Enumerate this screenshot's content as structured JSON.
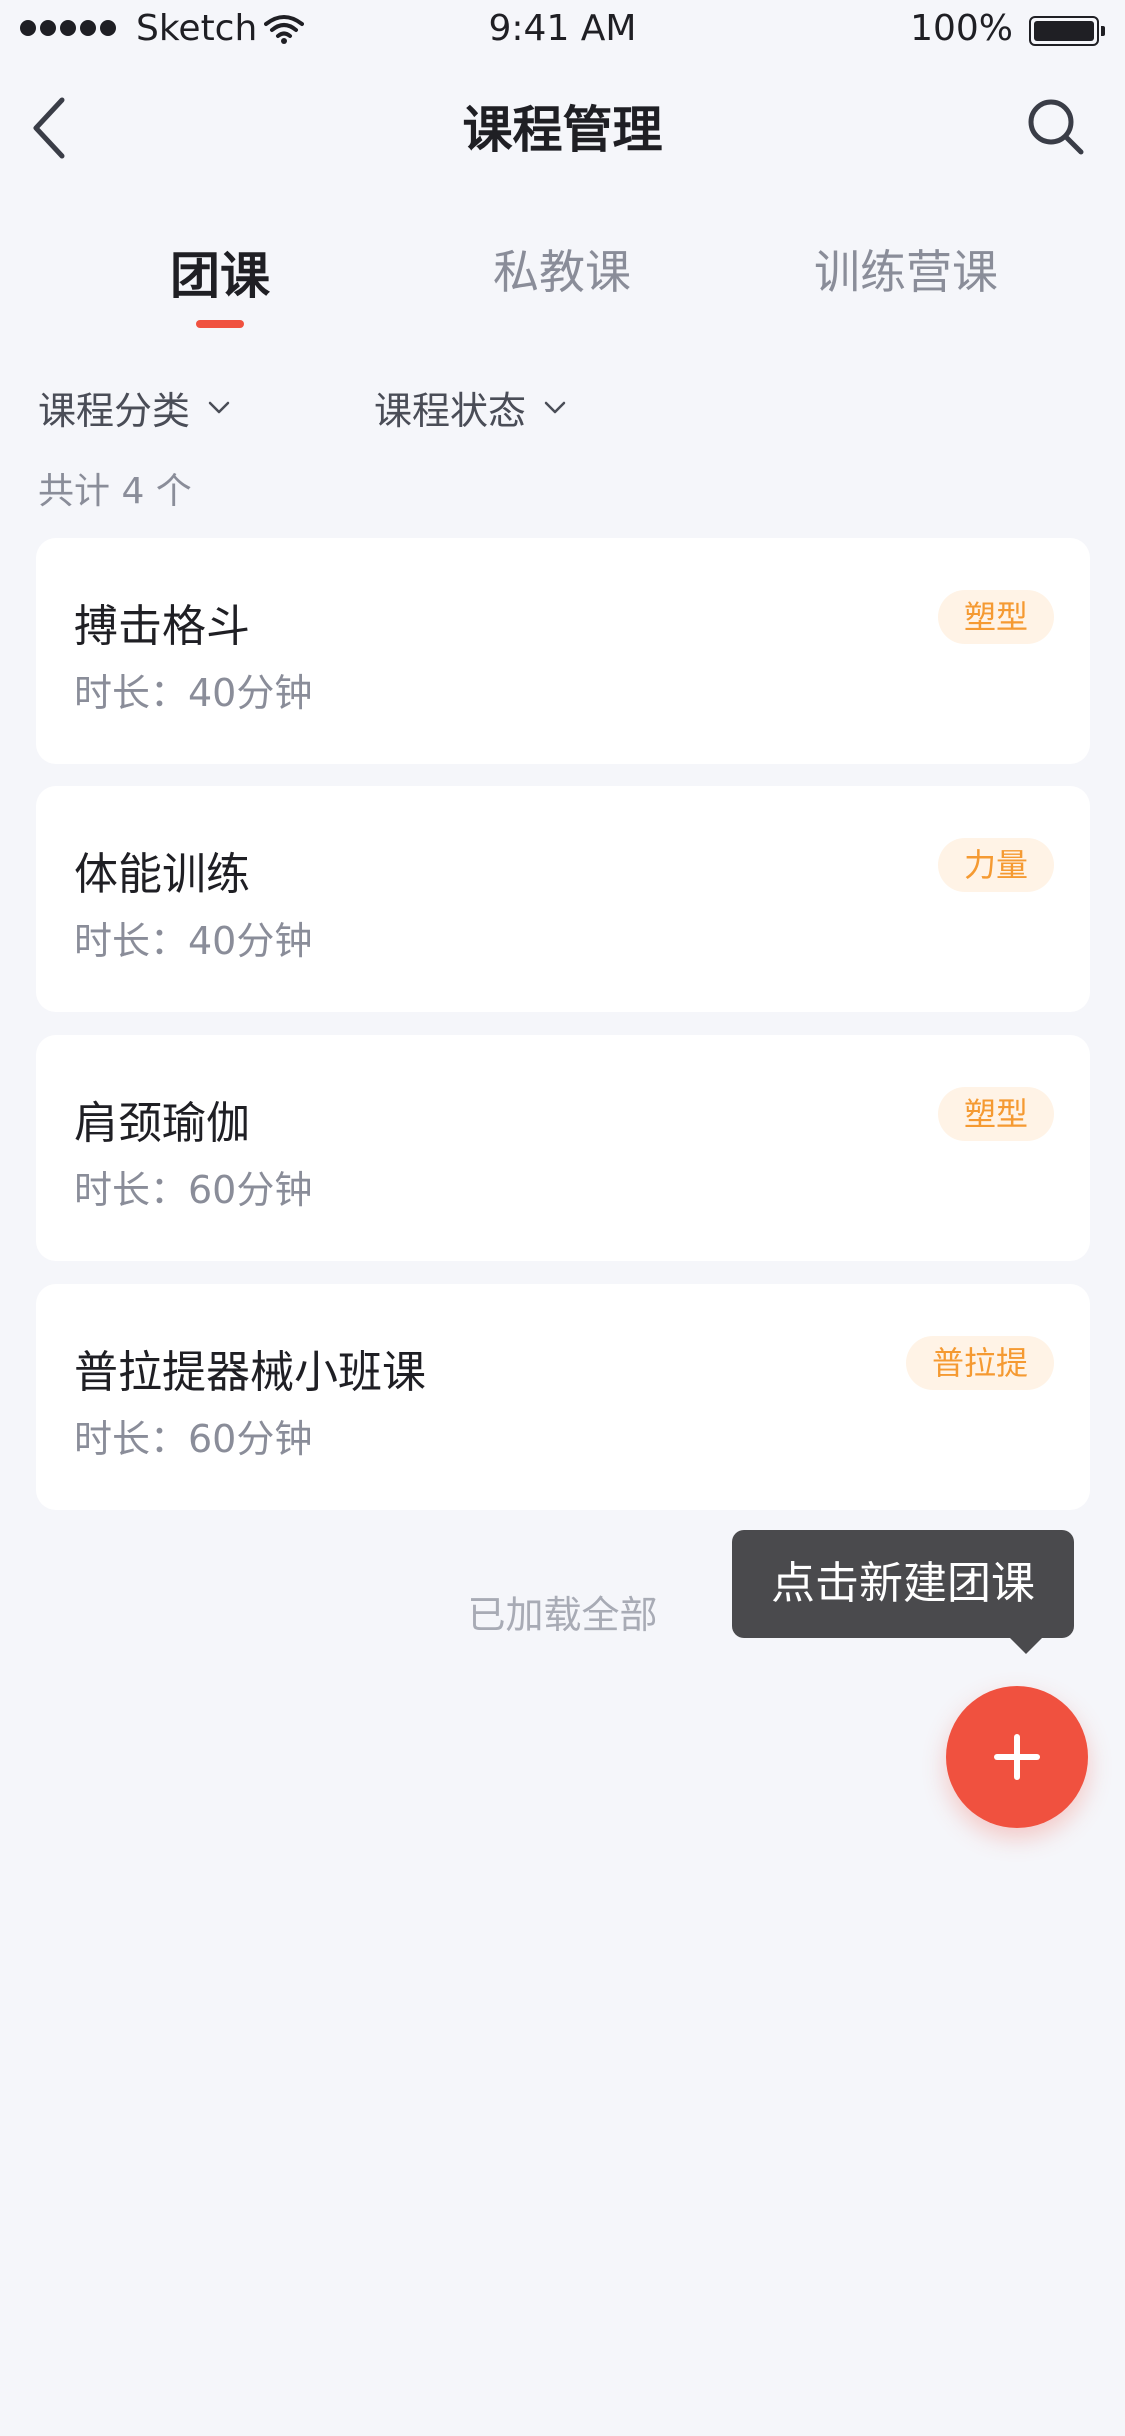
{
  "status_bar": {
    "carrier": "Sketch",
    "time": "9:41 AM",
    "battery": "100%"
  },
  "nav": {
    "title": "课程管理",
    "back_icon": "chevron-left-icon",
    "search_icon": "search-icon"
  },
  "tabs": [
    {
      "label": "团课",
      "active": true
    },
    {
      "label": "私教课",
      "active": false
    },
    {
      "label": "训练营课",
      "active": false
    }
  ],
  "filters": [
    {
      "label": "课程分类"
    },
    {
      "label": "课程状态"
    }
  ],
  "total_label": "共计 4 个",
  "courses": [
    {
      "name": "搏击格斗",
      "duration": "时长：40分钟",
      "tag": "塑型"
    },
    {
      "name": "体能训练",
      "duration": "时长：40分钟",
      "tag": "力量"
    },
    {
      "name": "肩颈瑜伽",
      "duration": "时长：60分钟",
      "tag": "塑型"
    },
    {
      "name": "普拉提器械小班课",
      "duration": "时长：60分钟",
      "tag": "普拉提"
    }
  ],
  "loaded_label": "已加载全部",
  "tooltip": "点击新建团课",
  "colors": {
    "accent": "#f0513f",
    "tag_text": "#f59a32",
    "tag_bg": "#fff3e6",
    "background": "#f5f6fa"
  }
}
